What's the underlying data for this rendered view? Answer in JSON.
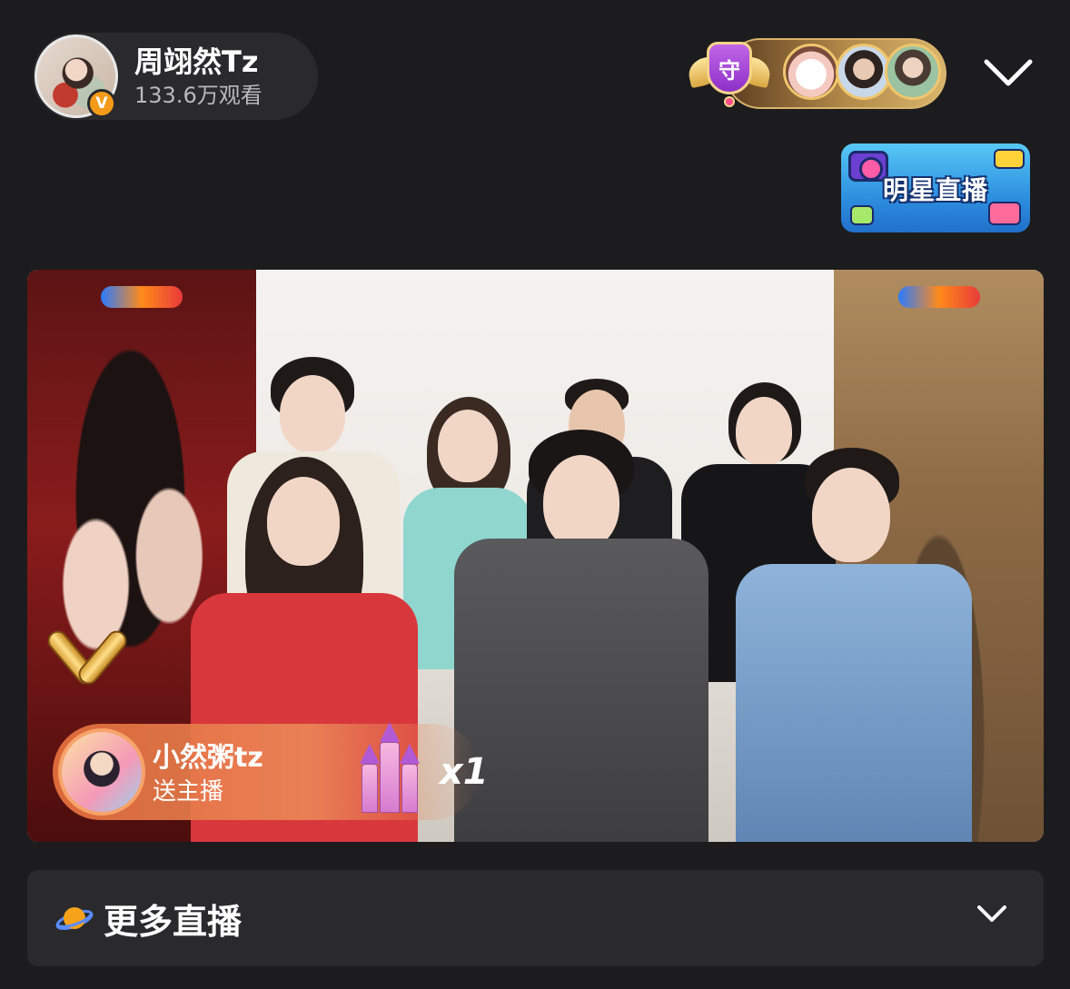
{
  "header": {
    "host_name": "周翊然Tz",
    "view_count": "133.6万观看",
    "verified_mark": "V",
    "guard_badge_text": "守",
    "icons": [
      "verified-badge-icon",
      "guard-shield-icon",
      "chevron-down-icon"
    ]
  },
  "banner": {
    "label": "明星直播"
  },
  "video": {
    "gift": {
      "sender": "小然粥tz",
      "action": "送主播",
      "count": "x1"
    }
  },
  "more_live": {
    "label": "更多直播",
    "icons": [
      "planet-icon",
      "chevron-down-icon"
    ]
  },
  "colors": {
    "background": "#1c1c1e",
    "card": "#2a2a2c",
    "verified": "#f39b18",
    "guard_purple": "#a24ae0",
    "gift_bar": "#e46e3c"
  }
}
